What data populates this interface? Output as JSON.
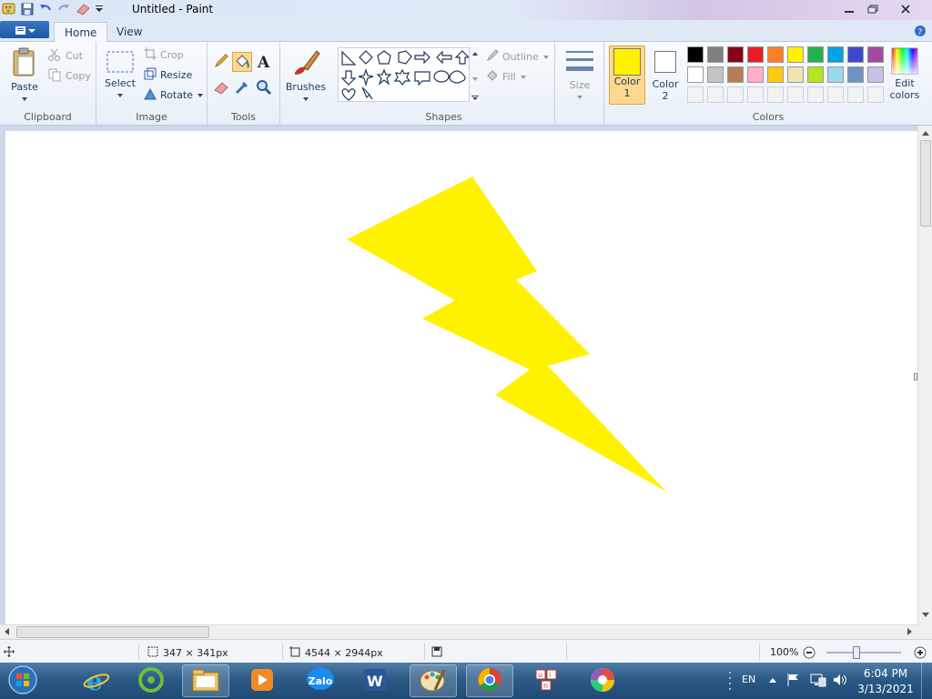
{
  "window": {
    "title": "Untitled - Paint"
  },
  "tabs": [
    {
      "label": "Home",
      "active": true
    },
    {
      "label": "View",
      "active": false
    }
  ],
  "clipboard": {
    "paste": "Paste",
    "cut": "Cut",
    "copy": "Copy",
    "group": "Clipboard"
  },
  "image": {
    "select": "Select",
    "crop": "Crop",
    "resize": "Resize",
    "rotate": "Rotate",
    "group": "Image"
  },
  "tools": {
    "group": "Tools",
    "brushes": "Brushes"
  },
  "shapes": {
    "outline": "Outline",
    "fill": "Fill",
    "group": "Shapes"
  },
  "size": {
    "label": "Size"
  },
  "colors": {
    "color1": {
      "line1": "Color",
      "line2": "1",
      "value": "#fff200"
    },
    "color2": {
      "line1": "Color",
      "line2": "2",
      "value": "#ffffff"
    },
    "edit_line1": "Edit",
    "edit_line2": "colors",
    "group": "Colors",
    "palette_row1": [
      "#000000",
      "#7f7f7f",
      "#880015",
      "#ed1c24",
      "#ff7f27",
      "#fff200",
      "#22b14c",
      "#00a2e8",
      "#3f48cc",
      "#a349a4"
    ],
    "palette_row2": [
      "#ffffff",
      "#c3c3c3",
      "#b97a57",
      "#ffaec9",
      "#ffc90e",
      "#efe4b0",
      "#b5e61d",
      "#99d9ea",
      "#7092be",
      "#c8bfe7"
    ]
  },
  "canvas": {
    "shape_color": "#fff200"
  },
  "status": {
    "selection_size": "347 × 341px",
    "image_size": "4544 × 2944px",
    "zoom": "100%",
    "zoom_fraction": 0.4
  },
  "taskbar": {
    "apps": [
      "start-orb",
      "internet-explorer",
      "coc-coc-browser",
      "file-explorer",
      "media-player",
      "zalo",
      "word",
      "paint",
      "chrome",
      "unikey",
      "color-app"
    ],
    "zalo_label": "Zalo",
    "lang": "EN",
    "time": "6:04 PM",
    "date": "3/13/2021"
  }
}
